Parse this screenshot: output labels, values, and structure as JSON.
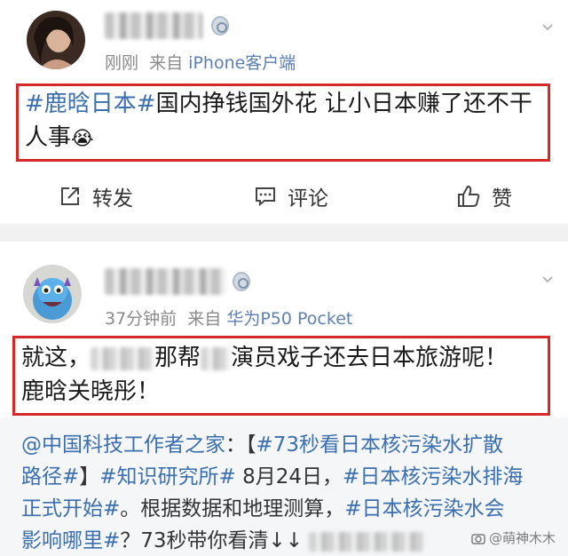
{
  "post1": {
    "username": "",
    "time": "刚刚",
    "via": "来自",
    "source": "iPhone客户端",
    "content": {
      "tag": "#鹿晗日本#",
      "line1_text": "国内挣钱国外花 让小日本赚了还不干",
      "line2_text": "人事",
      "emoji": "😭"
    },
    "actions": {
      "repost": "转发",
      "comment": "评论",
      "like": "赞"
    }
  },
  "post2": {
    "username": "",
    "time": "37分钟前",
    "via": "来自",
    "source": "华为P50 Pocket",
    "content": {
      "part1": "就这，",
      "part2": "那帮",
      "part3": "演员戏子还去日本旅游呢！",
      "line2": "鹿晗关晓彤！"
    }
  },
  "repost": {
    "mention": "@中国科技工作者之家",
    "colon": "：【",
    "tag1": "#73秒看日本核污染水扩散",
    "tag1b": "路径#",
    "bracket_close": "】",
    "tag2": "#知识研究所#",
    "date": " 8月24日，",
    "tag3": "#日本核污染水排海",
    "tag3b": "正式开始#",
    "text1": "。根据数据和地理测算，",
    "tag4": "#日本核污染水会",
    "tag4b": "影响哪里#",
    "text2": "？73秒带你看清↓↓"
  },
  "watermark": "@萌神木木",
  "colors": {
    "link": "#3b6fb0",
    "highlight_border": "#d62829",
    "meta": "#8a8a8a"
  }
}
